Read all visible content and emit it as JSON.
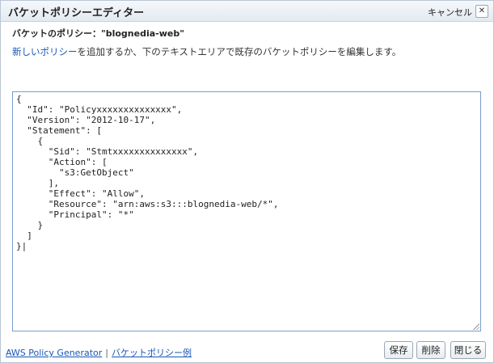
{
  "dialog": {
    "title": "バケットポリシーエディター",
    "cancel_label": "キャンセル",
    "close_glyph": "✕"
  },
  "policy_heading": "バケットのポリシー：\"blognedia-web\"",
  "instructions": {
    "link_text": "新しいポリシー",
    "text": "を追加するか、下のテキストエリアで既存のバケットポリシーを編集します。"
  },
  "editor": {
    "content": "{\n  \"Id\": \"Policyxxxxxxxxxxxxxx\",\n  \"Version\": \"2012-10-17\",\n  \"Statement\": [\n    {\n      \"Sid\": \"Stmtxxxxxxxxxxxxxx\",\n      \"Action\": [\n        \"s3:GetObject\"\n      ],\n      \"Effect\": \"Allow\",\n      \"Resource\": \"arn:aws:s3:::blognedia-web/*\",\n      \"Principal\": \"*\"\n    }\n  ]\n}|"
  },
  "footer": {
    "generator_link": "AWS Policy Generator",
    "separator": "|",
    "examples_link": "バケットポリシー例"
  },
  "buttons": {
    "save": "保存",
    "delete": "削除",
    "close": "閉じる"
  }
}
